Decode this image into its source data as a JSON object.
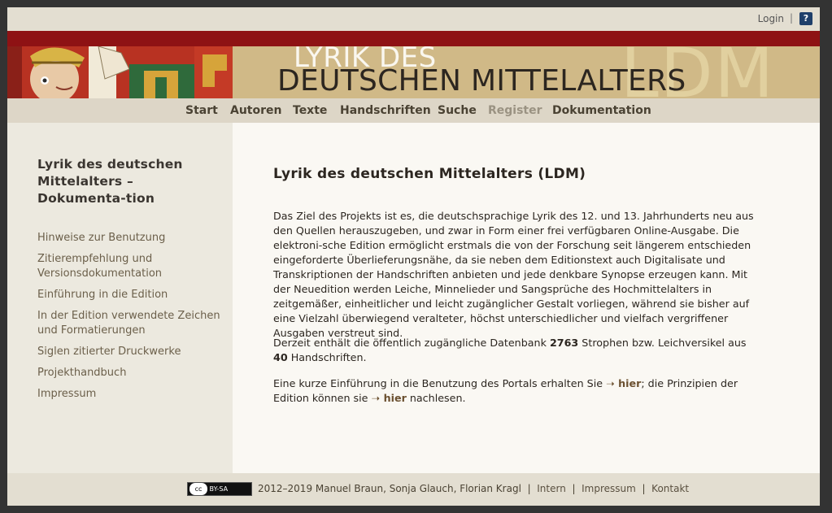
{
  "header": {
    "login_label": "Login",
    "separator": "|",
    "help_label": "?",
    "title_line1": "LYRIK DES",
    "title_line2": "DEUTSCHEN MITTELALTERS",
    "watermark": "LDM"
  },
  "nav": [
    {
      "label": "Start"
    },
    {
      "label": "Autoren"
    },
    {
      "label": "Texte"
    },
    {
      "label": "Handschriften"
    },
    {
      "label": "Suche"
    },
    {
      "label": "Register"
    },
    {
      "label": "Dokumentation"
    }
  ],
  "sidebar": {
    "title": "Lyrik des deutschen Mittelalters – Dokumenta-tion",
    "links": [
      {
        "label": "Hinweise zur Benutzung"
      },
      {
        "label": "Zitierempfehlung und Versionsdokumentation"
      },
      {
        "label": "Einführung in die Edition"
      },
      {
        "label": "In der Edition verwendete Zeichen und Formatierungen"
      },
      {
        "label": "Siglen zitierter Druckwerke"
      },
      {
        "label": "Projekthandbuch"
      },
      {
        "label": "Impressum"
      }
    ]
  },
  "main": {
    "title": "Lyrik des deutschen Mittelalters (LDM)",
    "para1": "Das Ziel des Projekts ist es, die deutschsprachige Lyrik des 12. und 13. Jahrhunderts neu aus den Quellen herauszugeben, und zwar in Form einer frei verfügbaren Online-Ausgabe. Die elektroni-sche Edition ermöglicht erstmals die von der Forschung seit längerem entschieden eingeforderte Überlieferungsnähe, da sie neben dem Editionstext auch Digitalisate und Transkriptionen der Handschriften anbieten und jede denkbare Synopse erzeugen kann. Mit der Neuedition werden Leiche, Minnelieder und Sangsprüche des Hochmittelalters in zeitgemäßer, einheitlicher und leicht zugänglicher Gestalt vorliegen, während sie bisher auf eine Vielzahl überwiegend veralteter, höchst unterschiedlicher und vielfach vergriffener Ausgaben verstreut sind.",
    "para2_a": "Derzeit enthält die öffentlich zugängliche Datenbank ",
    "para2_count_strophes": "2763",
    "para2_b": " Strophen bzw. Leichversikel aus ",
    "para2_count_manuscripts": "40",
    "para2_c": " Handschriften.",
    "para3_a": "Eine kurze Einführung in die Benutzung des Portals erhalten Sie ",
    "para3_link1": "➝ hier",
    "para3_b": "; die Prinzipien der Edition können sie ",
    "para3_link2": "➝ hier",
    "para3_c": " nachlesen."
  },
  "footer": {
    "cc_a": "cc",
    "cc_b": "BY-SA",
    "copyright": "2012–2019  Manuel Braun, Sonja Glauch, Florian Kragl",
    "sep": "|",
    "link_intern": "Intern",
    "link_impressum": "Impressum",
    "link_kontakt": "Kontakt"
  },
  "colors": {
    "red_band": "#8e1214",
    "banner_gold": "#d0b987",
    "link_brown": "#6b5030",
    "help_blue": "#1f3f6a"
  }
}
